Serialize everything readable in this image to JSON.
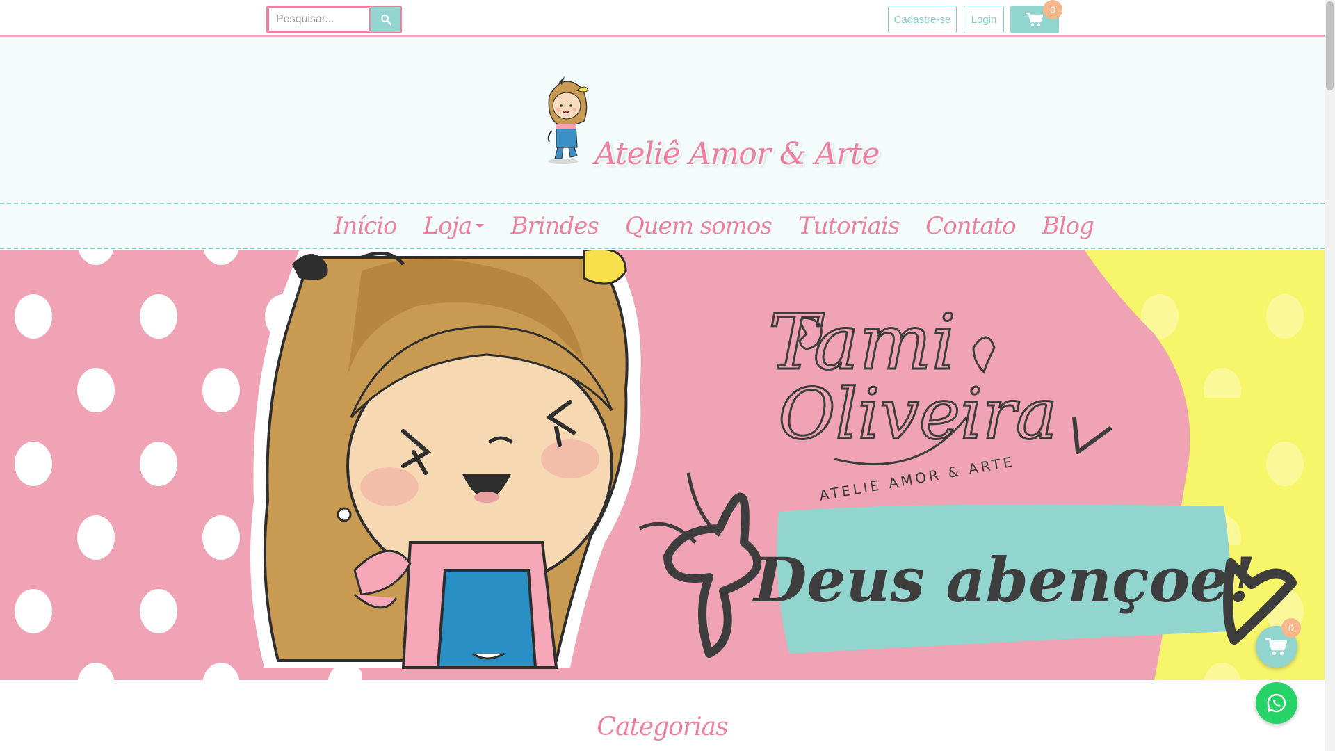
{
  "search": {
    "placeholder": "Pesquisar..."
  },
  "header_actions": {
    "signup_label": "Cadastre-se",
    "login_label": "Login",
    "cart_count": "0"
  },
  "logo": {
    "text": "Ateliê Amor & Arte"
  },
  "nav": {
    "items": [
      {
        "label": "Início"
      },
      {
        "label": "Loja"
      },
      {
        "label": "Brindes"
      },
      {
        "label": "Quem somos"
      },
      {
        "label": "Tutoriais"
      },
      {
        "label": "Contato"
      },
      {
        "label": "Blog"
      }
    ]
  },
  "banner": {
    "signature_line1": "Tami",
    "signature_line2": "Oliveira",
    "signature_sub": "ATELIE AMOR & ARTE",
    "tagline": "Deus abençoe!"
  },
  "sections": {
    "categories_title": "Categorias"
  },
  "floating": {
    "cart_count": "0"
  },
  "colors": {
    "brand_pink": "#ee7fa0",
    "teal": "#91d5ce",
    "banner_pink": "#f0a3b5",
    "banner_yellow": "#f7f56a",
    "badge_orange": "#f6b88a",
    "whatsapp_green": "#25d366"
  },
  "icons": [
    "search-icon",
    "cart-icon",
    "whatsapp-icon",
    "caret-down-icon"
  ]
}
